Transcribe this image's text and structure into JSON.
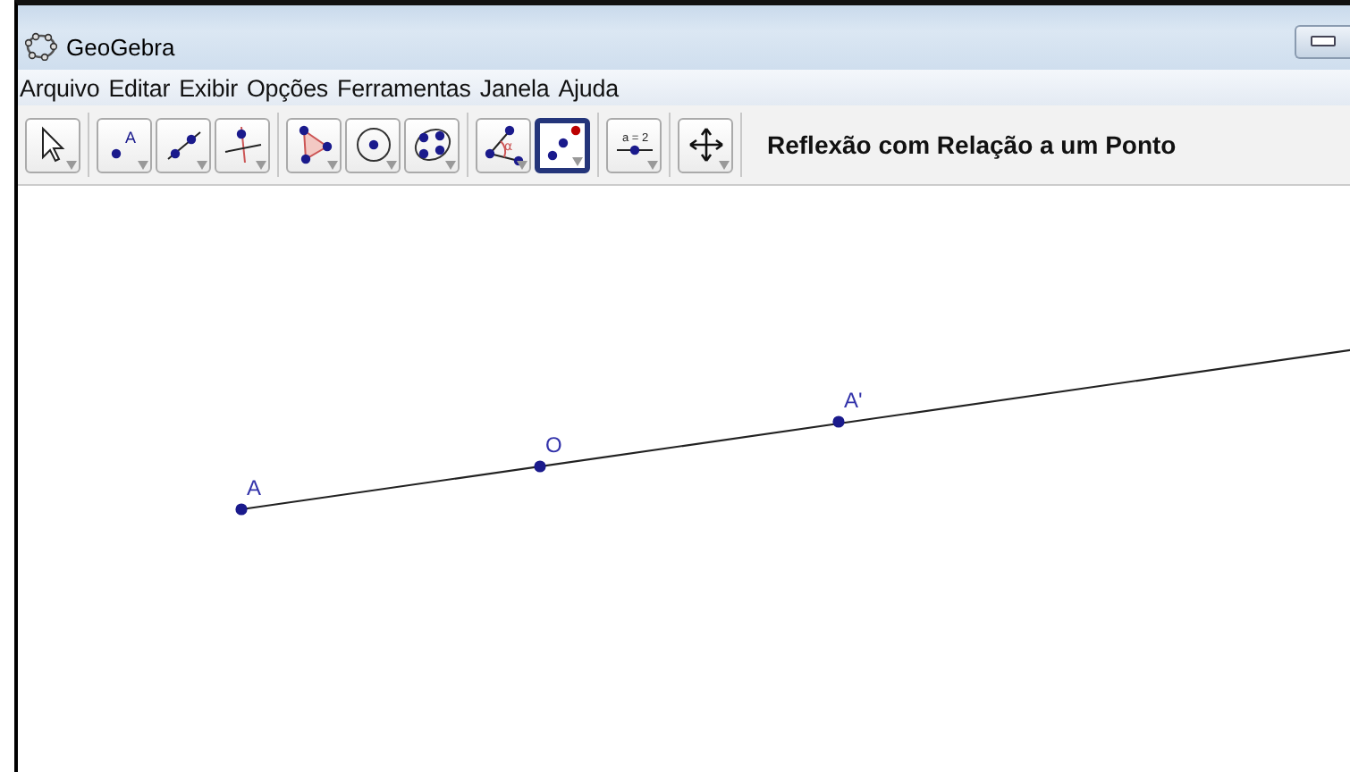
{
  "window": {
    "title": "GeoGebra"
  },
  "menu": [
    "Arquivo",
    "Editar",
    "Exibir",
    "Opções",
    "Ferramentas",
    "Janela",
    "Ajuda"
  ],
  "toolbar": {
    "groups": [
      {
        "tools": [
          {
            "kind": "move",
            "selected": false
          }
        ]
      },
      {
        "tools": [
          {
            "kind": "point",
            "selected": false,
            "label": "A"
          },
          {
            "kind": "line",
            "selected": false
          },
          {
            "kind": "perpendicular",
            "selected": false
          }
        ]
      },
      {
        "tools": [
          {
            "kind": "polygon",
            "selected": false
          },
          {
            "kind": "circle",
            "selected": false
          },
          {
            "kind": "conic",
            "selected": false
          }
        ]
      },
      {
        "tools": [
          {
            "kind": "angle",
            "selected": false,
            "label": "α"
          },
          {
            "kind": "reflect",
            "selected": true
          }
        ]
      },
      {
        "tools": [
          {
            "kind": "slider",
            "selected": false,
            "label": "a = 2"
          }
        ]
      },
      {
        "tools": [
          {
            "kind": "pan",
            "selected": false
          }
        ]
      }
    ],
    "tool_name": "Reflexão com Relação a um Ponto"
  },
  "canvas": {
    "points": [
      {
        "label": "A"
      },
      {
        "label": "O"
      },
      {
        "label": "A'"
      }
    ]
  }
}
